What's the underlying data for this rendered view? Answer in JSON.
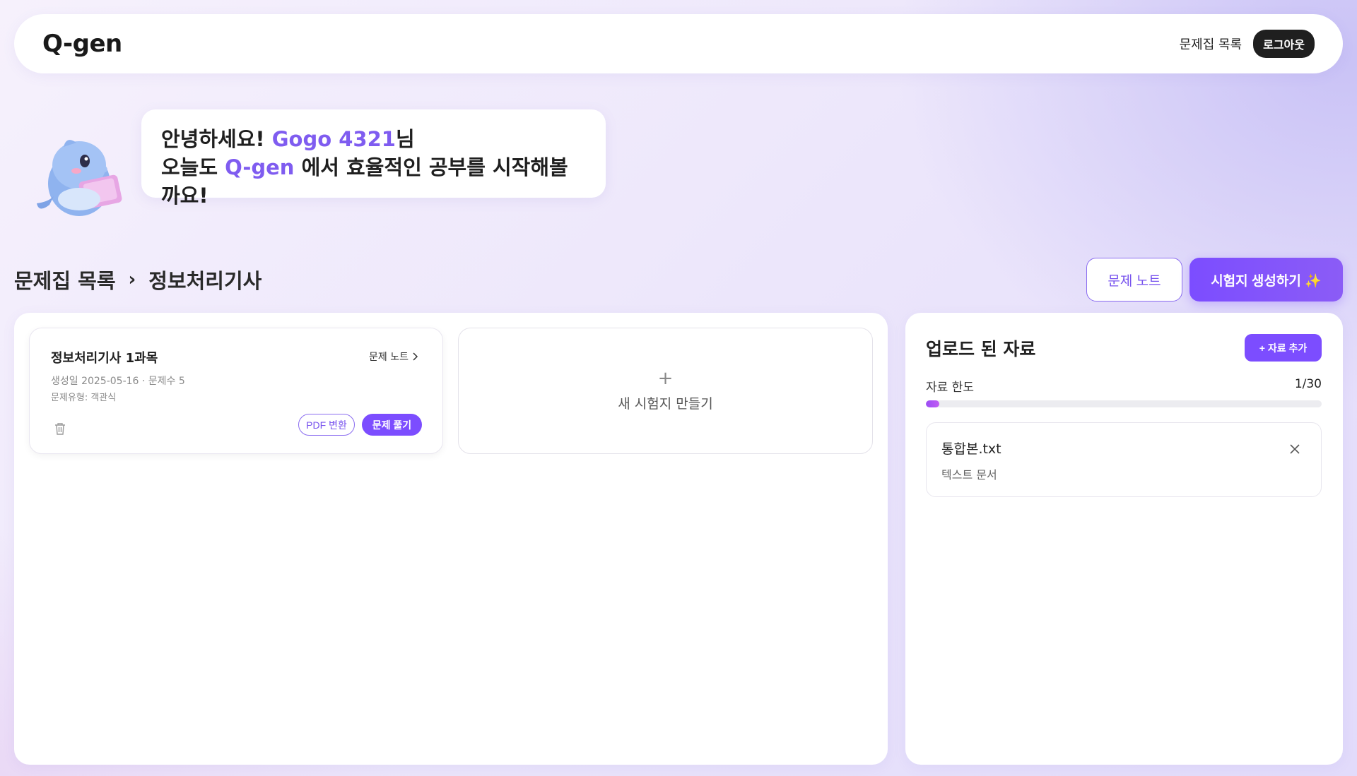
{
  "header": {
    "logo": "Q-gen",
    "nav_link": "문제집 목록",
    "logout_label": "로그아웃"
  },
  "greeting": {
    "hello": "안녕하세요!",
    "username": "Gogo 4321",
    "honorific": "님",
    "line2_prefix": "오늘도",
    "brand": "Q-gen",
    "line2_suffix": "에서 효율적인 공부를 시작해볼까요!"
  },
  "breadcrumb": {
    "root": "문제집 목록",
    "separator": "›",
    "current": "정보처리기사"
  },
  "actions": {
    "note_label": "문제 노트",
    "generate_label": "시험지 생성하기 ✨"
  },
  "exam_cards": [
    {
      "title": "정보처리기사 1과목",
      "note_link": "문제 노트",
      "meta": "생성일 2025-05-16 · 문제수 5",
      "type": "문제유형: 객관식",
      "pdf_label": "PDF 변환",
      "solve_label": "문제 풀기"
    }
  ],
  "new_card": {
    "plus": "+",
    "label": "새 시험지 만들기"
  },
  "uploads": {
    "title": "업로드 된 자료",
    "add_label": "+ 자료 추가",
    "quota_label": "자료 한도",
    "quota_count": "1/30",
    "quota_fraction": 0.0333,
    "files": [
      {
        "name": "통합본.txt",
        "type": "텍스트 문서"
      }
    ]
  },
  "colors": {
    "accent": "#7c4dff",
    "accent_text": "#7f5cf0"
  }
}
